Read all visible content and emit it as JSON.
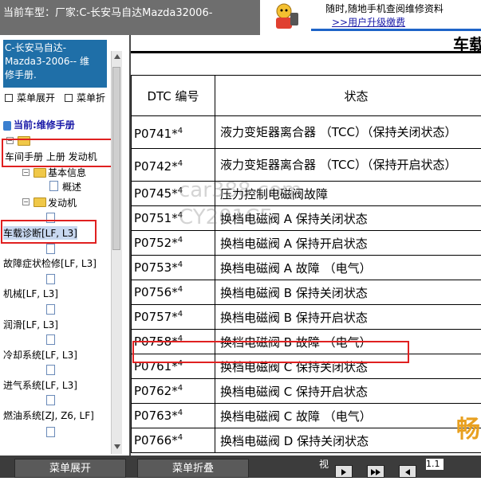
{
  "header": {
    "car_title": "当前车型：厂家:C-长安马自达Mazda32006-",
    "ad_line1": "随时,随地手机查阅维修资料",
    "ad_line2": ">>用户升级缴费"
  },
  "left_panel": {
    "manual_title_lines": [
      "C-长安马自达-",
      "Mazda3-2006-- 维",
      "修手册."
    ],
    "expand_label": "菜单展开",
    "collapse_label": "菜单折",
    "current_label": "当前:维修手册",
    "tree": {
      "manual_path": "车间手册 上册 发动机",
      "basic_info": "基本信息",
      "overview": "概述",
      "engine": "发动机",
      "onboard_diag": "车载诊断[LF, L3]",
      "symptom_check": "故障症状检修[LF, L3]",
      "mechanical": "机械[LF, L3]",
      "lubrication": "润滑[LF, L3]",
      "cooling": "冷却系统[LF, L3]",
      "intake": "进气系统[LF, L3]",
      "fuel": "燃油系统[ZJ, Z6, LF]"
    }
  },
  "content": {
    "section_header": "车载",
    "table": {
      "header_code": "DTC 编号",
      "header_status": "状态",
      "superscript": "4",
      "rows": [
        {
          "code": "P0741*",
          "status": "液力变矩器离合器 （TCC）（保持关闭状态）"
        },
        {
          "code": "P0742*",
          "status": "液力变矩器离合器 （TCC）（保持开启状态）"
        },
        {
          "code": "P0745*",
          "status": "压力控制电磁阀故障"
        },
        {
          "code": "P0751*",
          "status": "换档电磁阀 A 保持关闭状态"
        },
        {
          "code": "P0752*",
          "status": "换档电磁阀 A 保持开启状态"
        },
        {
          "code": "P0753*",
          "status": "换档电磁阀 A 故障 （电气）"
        },
        {
          "code": "P0756*",
          "status": "换档电磁阀 B 保持关闭状态"
        },
        {
          "code": "P0757*",
          "status": "换档电磁阀 B 保持开启状态"
        },
        {
          "code": "P0758*",
          "status": "换档电磁阀 B 故障 （电气）"
        },
        {
          "code": "P0761*",
          "status": "换档电磁阀 C 保持关闭状态"
        },
        {
          "code": "P0762*",
          "status": "换档电磁阀 C 保持开启状态"
        },
        {
          "code": "P0763*",
          "status": "换档电磁阀 C 故障 （电气）"
        },
        {
          "code": "P0766*",
          "status": "换档电磁阀 D 保持关闭状态"
        }
      ]
    },
    "watermark_lines": [
      "car388.com",
      "CY201CF"
    ],
    "corner_glyph": "畅"
  },
  "bottom_bar": {
    "expand_button": "菜单展开",
    "collapse_button": "菜单折叠",
    "view_label": "视",
    "page_number": "1.1"
  },
  "colors": {
    "highlight_red": "#e02020",
    "manual_box_blue": "#1f6fa8",
    "toolbar_gray": "#6e6e6e"
  }
}
